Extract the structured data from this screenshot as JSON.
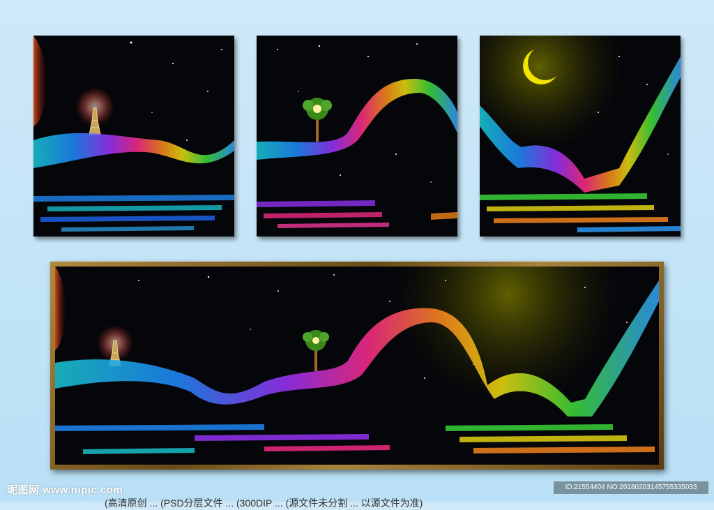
{
  "watermark": {
    "site": "昵图网 www.nipic.com",
    "id_text": "ID:21554404 NO:20180203145755335033"
  },
  "caption": "(高清原创 ... (PSD分层文件 ... (300DIP ... (源文件未分割 ... 以源文件为准)",
  "colors": {
    "background": "#c4e4f7",
    "frame": "#8a6a2a",
    "night": "#05060a",
    "moon": "#f2e400"
  }
}
